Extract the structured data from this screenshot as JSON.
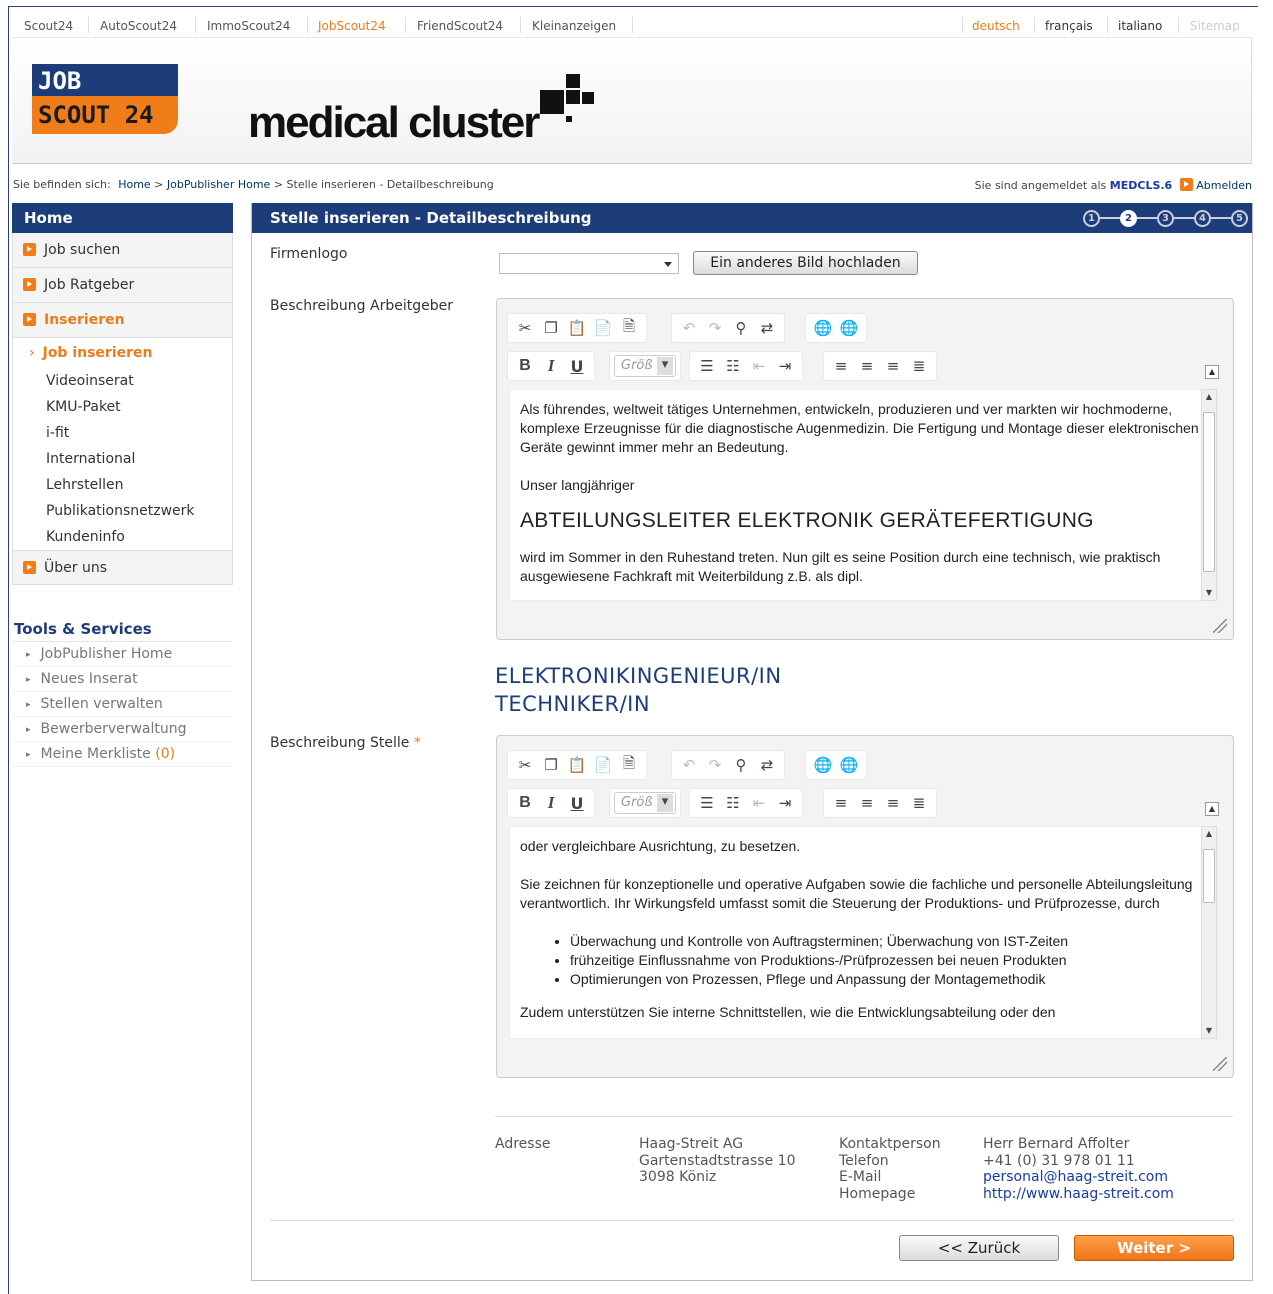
{
  "topnav": {
    "sites": [
      "Scout24",
      "AutoScout24",
      "ImmoScout24",
      "JobScout24",
      "FriendScout24",
      "Kleinanzeigen"
    ],
    "languages": [
      "deutsch",
      "français",
      "italiano"
    ],
    "sitemap": "Sitemap"
  },
  "brand": {
    "logo_line1": "JOB",
    "logo_line2": "SCOUT 24",
    "title": "medical cluster"
  },
  "breadcrumb": {
    "prefix": "Sie befinden sich:",
    "home": "Home",
    "sep": ">",
    "jobpublisher": "JobPublisher Home",
    "current": "Stelle inserieren - Detailbeschreibung"
  },
  "login": {
    "prefix": "Sie sind angemeldet als",
    "user": "MEDCLS.6",
    "logout": "Abmelden"
  },
  "sidebar": {
    "home": "Home",
    "items": [
      "Job suchen",
      "Job Ratgeber",
      "Inserieren"
    ],
    "sub": [
      "Job inserieren",
      "Videoinserat",
      "KMU-Paket",
      "i-fit",
      "International",
      "Lehrstellen",
      "Publikationsnetzwerk",
      "Kundeninfo"
    ],
    "last": "Über uns"
  },
  "tools": {
    "title": "Tools & Services",
    "items": [
      "JobPublisher Home",
      "Neues Inserat",
      "Stellen verwalten",
      "Bewerberverwaltung",
      "Meine Merkliste"
    ],
    "merk_count": "(0)"
  },
  "main": {
    "title": "Stelle inserieren - Detailbeschreibung",
    "steps": [
      "1",
      "2",
      "3",
      "4",
      "5"
    ],
    "current_step": 2
  },
  "form": {
    "firmenlogo_label": "Firmenlogo",
    "upload_button": "Ein anderes Bild hochladen",
    "arbeitgeber_label": "Beschreibung Arbeitgeber",
    "stelle_label": "Beschreibung Stelle",
    "required_mark": "*",
    "size_placeholder": "Größ"
  },
  "editor1": {
    "p1": "Als führendes, weltweit tätiges Unternehmen, entwickeln, produzieren und ver markten wir hochmoderne, komplexe Erzeugnisse für die diagnostische Augenmedizin. Die Fertigung und Montage dieser elektronischen Geräte gewinnt immer mehr an Bedeutung.",
    "p2": "Unser langjähriger",
    "heading": "ABTEILUNGSLEITER ELEKTRONIK GERÄTEFERTIGUNG",
    "p3": "wird im Sommer in den Ruhestand treten. Nun gilt es seine Position durch eine technisch, wie praktisch ausgewiesene Fachkraft mit Weiterbildung z.B. als dipl."
  },
  "stelle_title": {
    "line1": "ELEKTRONIKINGENIEUR/IN",
    "line2": "TECHNIKER/IN"
  },
  "editor2": {
    "p1": "oder vergleichbare Ausrichtung, zu besetzen.",
    "p2": "Sie zeichnen für konzeptionelle und operative Aufgaben sowie die fachliche und personelle Abteilungsleitung verantwortlich. Ihr Wirkungsfeld umfasst somit die Steuerung der Produktions- und Prüfprozesse, durch",
    "bullets": [
      "Überwachung und Kontrolle von Auftragsterminen; Überwachung von IST-Zeiten",
      "frühzeitige Einflussnahme von Produktions-/Prüfprozessen bei neuen Produkten",
      "Optimierungen von Prozessen, Pflege und Anpassung der Montagemethodik"
    ],
    "p3": "Zudem unterstützen Sie interne Schnittstellen, wie die Entwicklungsabteilung oder den"
  },
  "contact": {
    "address_label": "Adresse",
    "company": "Haag-Streit AG",
    "street": "Gartenstadtstrasse 10",
    "city": "3098 Köniz",
    "labels": [
      "Kontaktperson",
      "Telefon",
      "E-Mail",
      "Homepage"
    ],
    "person": "Herr Bernard Affolter",
    "phone": "+41 (0) 31 978 01 11",
    "email": "personal@haag-streit.com",
    "homepage": "http://www.haag-streit.com"
  },
  "buttons": {
    "back": "<< Zurück",
    "next": "Weiter >"
  },
  "colors": {
    "navy": "#1d3d7a",
    "orange": "#f07d1a"
  }
}
